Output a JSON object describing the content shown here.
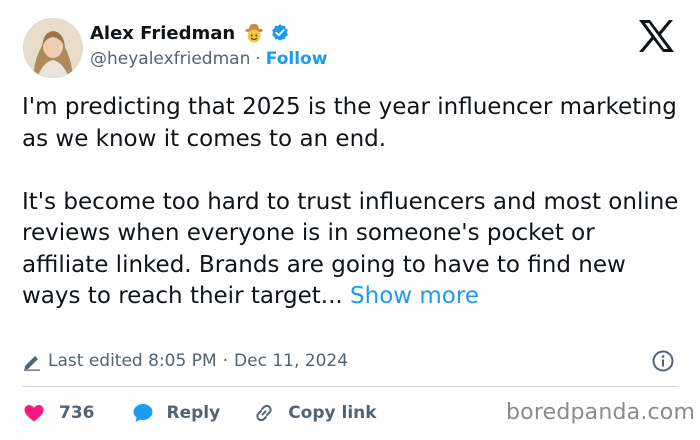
{
  "author": {
    "display_name": "Alex Friedman",
    "handle": "@heyalexfriedman",
    "separator": "·",
    "follow_label": "Follow",
    "badge_emoji": "cowboy-face",
    "verified": true
  },
  "tweet": {
    "paragraph_1": "I'm predicting that 2025 is the year influencer marketing as we know it comes to an end.",
    "paragraph_2": "It's become too hard to trust influencers and most online reviews when everyone is in someone's pocket or affiliate linked. Brands are going to have to find new ways to reach their target...",
    "show_more_label": "Show more"
  },
  "meta": {
    "edited_label": "Last edited 8:05 PM",
    "separator": "·",
    "date": "Dec 11, 2024"
  },
  "actions": {
    "like_count": "736",
    "reply_label": "Reply",
    "copy_link_label": "Copy link"
  },
  "watermark": "boredpanda.com",
  "colors": {
    "accent": "#1d9bf0",
    "like": "#f91880",
    "text": "#0f1419",
    "muted": "#536471"
  },
  "icons": [
    "x-logo-icon",
    "verified-badge-icon",
    "cowboy-emoji-icon",
    "pencil-icon",
    "info-icon",
    "heart-icon",
    "reply-bubble-icon",
    "link-icon"
  ]
}
